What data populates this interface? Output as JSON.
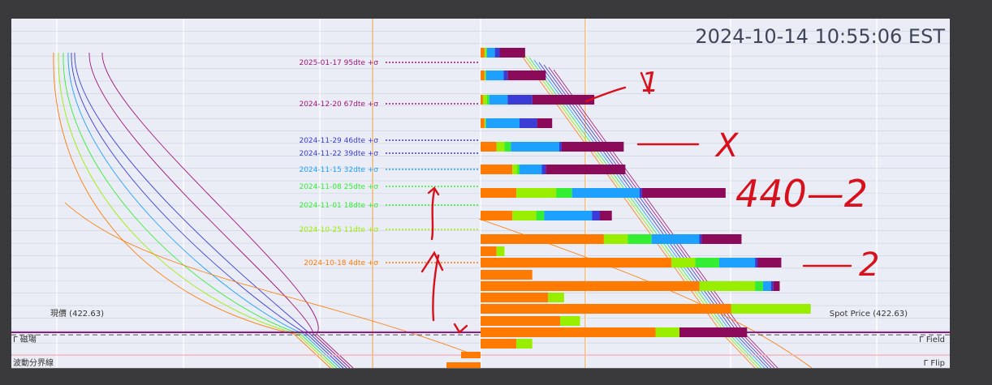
{
  "timestamp": "2024-10-14 10:55:06 EST",
  "chart_data": {
    "type": "bar",
    "title": "",
    "spot_price": 422.63,
    "ylim": [
      419,
      447
    ],
    "expiry_labels": [
      {
        "label": "2025-01-17 95dte +σ",
        "y": 445.2,
        "color": "#a0157a"
      },
      {
        "label": "2024-12-20 67dte +σ",
        "y": 440.7,
        "color": "#a0157a"
      },
      {
        "label": "2024-11-29 46dte +σ",
        "y": 436.1,
        "color": "#3b3bd6"
      },
      {
        "label": "2024-11-22 39dte +σ",
        "y": 434.6,
        "color": "#3b3bd6"
      },
      {
        "label": "2024-11-15 32dte +σ",
        "y": 432.6,
        "color": "#1ea0ff"
      },
      {
        "label": "2024-11-08 25dte +σ",
        "y": 430.5,
        "color": "#33ee33"
      },
      {
        "label": "2024-11-01 18dte +σ",
        "y": 428.4,
        "color": "#33ee33"
      },
      {
        "label": "2024-10-25 11dte +σ",
        "y": 426.1,
        "color": "#99ee00"
      },
      {
        "label": "2024-10-18 4dte +σ",
        "y": 423.8,
        "color": "#ff7a00"
      }
    ],
    "spot_label_left": "現價 (422.63)",
    "spot_label_right": "Spot Price (422.63)",
    "field_label_left": "Γ 磁場",
    "field_label_right": "Γ Field",
    "field_level": 420.3,
    "flip_label_left": "波動分界線",
    "flip_label_right": "Γ Flip",
    "flip_level": 419.4,
    "bar_colors": [
      "#ff7a00",
      "#99ee00",
      "#33ee33",
      "#1ea0ff",
      "#3b3bd6",
      "#8b0a5a"
    ],
    "bars": [
      {
        "y": 445.5,
        "segments": [
          0.5,
          0.2,
          0.1,
          1.0,
          0.6,
          3.2
        ]
      },
      {
        "y": 443.4,
        "segments": [
          0.5,
          0.1,
          0.1,
          2.2,
          0.5,
          4.8
        ]
      },
      {
        "y": 441.2,
        "segments": [
          0.3,
          0.5,
          0.3,
          2.3,
          3.1,
          7.8
        ]
      },
      {
        "y": 439.0,
        "segments": [
          0.5,
          0.1,
          0.1,
          4.2,
          2.2,
          1.9
        ]
      },
      {
        "y": 436.8,
        "segments": [
          2.0,
          1.0,
          0.8,
          6.1,
          0.3,
          7.8
        ]
      },
      {
        "y": 434.7,
        "segments": [
          4.0,
          0.6,
          0.3,
          2.8,
          0.5,
          10.0
        ]
      },
      {
        "y": 432.6,
        "segments": [
          4.5,
          5.0,
          2.0,
          8.5,
          0.3,
          10.5
        ]
      },
      {
        "y": 430.4,
        "segments": [
          4.0,
          3.0,
          1.0,
          6.0,
          1.0,
          1.5
        ]
      },
      {
        "y": 428.3,
        "segments": [
          15.5,
          3.0,
          3.0,
          6.0,
          0.3,
          5.0
        ]
      },
      {
        "y": 427.0,
        "segments": [
          2.0,
          1.0,
          0.0,
          0.0,
          0.0,
          0.0
        ]
      },
      {
        "y": 426.1,
        "segments": [
          24.0,
          3.0,
          3.0,
          4.5,
          0.3,
          3.0
        ]
      },
      {
        "y": 425.0,
        "segments": [
          6.5,
          0.0,
          0.0,
          0.0,
          0.0,
          0.0
        ]
      },
      {
        "y": 423.9,
        "segments": [
          27.5,
          7.0,
          1.0,
          1.0,
          0.3,
          0.8
        ]
      },
      {
        "y": 422.8,
        "segments": [
          8.5,
          2.0,
          0.0,
          0.0,
          0.0,
          0.0
        ]
      },
      {
        "y": 421.7,
        "segments": [
          31.5,
          10.0,
          0.0,
          0.0,
          0.0,
          0.0
        ]
      },
      {
        "y": 420.6,
        "segments": [
          10.0,
          2.5,
          0.0,
          0.0,
          0.0,
          0.0
        ]
      },
      {
        "y": 419.5,
        "segments": [
          22.0,
          3.0,
          0.0,
          0.0,
          0.0,
          8.5
        ]
      },
      {
        "y": 418.4,
        "segments": [
          4.5,
          2.0,
          0.0,
          0.0,
          0.0,
          0.0
        ]
      }
    ],
    "annotations": [
      {
        "text": "1"
      },
      {
        "text": "X"
      },
      {
        "text": "440—2"
      },
      {
        "text": "2"
      }
    ]
  }
}
